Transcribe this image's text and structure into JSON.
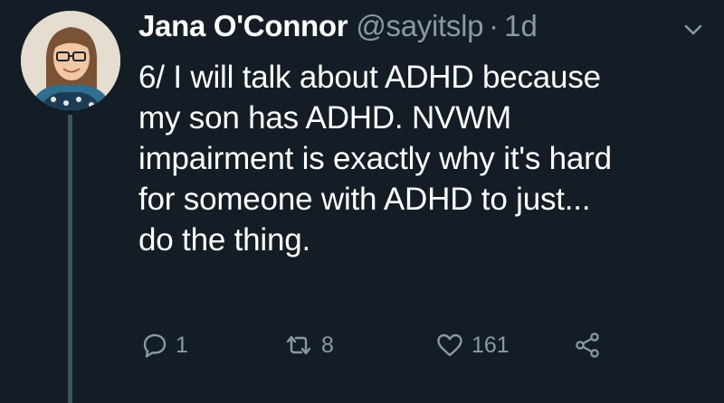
{
  "tweet": {
    "author_name": "Jana O'Connor",
    "author_handle": "@sayitslp",
    "separator": "·",
    "timestamp": "1d",
    "text_lines": [
      "6/ I will talk about ADHD because",
      "my son has ADHD. NVWM",
      "impairment is exactly why it's hard",
      "for someone with ADHD to just...",
      "do the thing."
    ],
    "actions": {
      "reply_count": "1",
      "retweet_count": "8",
      "like_count": "161"
    }
  },
  "colors": {
    "background": "#141d26",
    "secondary_text": "#8899a6",
    "primary_text": "#ffffff",
    "thread_line": "#3d5466"
  },
  "icons": {
    "reply": "reply-icon",
    "retweet": "retweet-icon",
    "like": "heart-icon",
    "share": "share-icon",
    "menu": "chevron-down-icon"
  }
}
